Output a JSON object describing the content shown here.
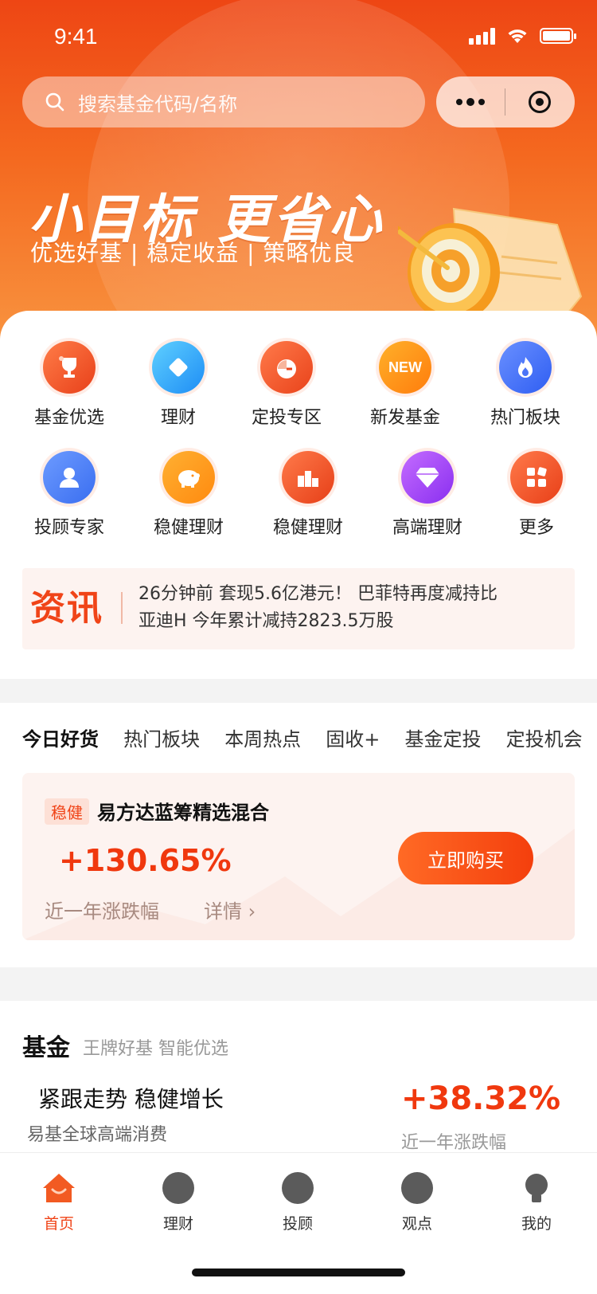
{
  "status_bar": {
    "time": "9:41"
  },
  "search": {
    "placeholder": "搜索基金代码/名称"
  },
  "hero": {
    "slogan": "小目标 更省心",
    "subslogan": "优选好基 | 稳定收益 | 策略优良"
  },
  "menu": [
    {
      "label": "基金优选",
      "icon": "trophy-icon"
    },
    {
      "label": "理财",
      "icon": "diamond-icon"
    },
    {
      "label": "定投专区",
      "icon": "clock-icon"
    },
    {
      "label": "新发基金",
      "icon": "new-badge-icon",
      "badge": "NEW"
    },
    {
      "label": "热门板块",
      "icon": "flame-icon"
    },
    {
      "label": "投顾专家",
      "icon": "person-icon"
    },
    {
      "label": "稳健理财",
      "icon": "piggy-bank-icon"
    },
    {
      "label": "稳健理财",
      "icon": "podium-icon"
    },
    {
      "label": "高端理财",
      "icon": "gem-icon"
    },
    {
      "label": "更多",
      "icon": "grid-icon"
    }
  ],
  "news": {
    "title": "资讯",
    "line1": "26分钟前 套现5.6亿港元！ 巴菲特再度减持比",
    "line2": "亚迪H 今年累计减持2823.5万股"
  },
  "today": {
    "tabs": [
      "今日好货",
      "热门板块",
      "本周热点",
      "固收+",
      "基金定投",
      "定投机会"
    ],
    "card": {
      "tag": "稳健",
      "name": "易方达蓝筹精选混合",
      "rate": "+130.65%",
      "rate_label": "近一年涨跌幅",
      "detail": "详情 ›",
      "buy": "立即购买"
    }
  },
  "fund_section": {
    "title": "基金",
    "subtitle": "王牌好基 智能优选",
    "pick_title": "紧跟走势 稳健增长",
    "pick_sub": "易基全球高端消费",
    "pick_rate": "+38.32%",
    "pick_rate_label": "近一年涨跌幅"
  },
  "tabbar": [
    {
      "label": "首页",
      "active": true
    },
    {
      "label": "理财",
      "active": false
    },
    {
      "label": "投顾",
      "active": false
    },
    {
      "label": "观点",
      "active": false
    },
    {
      "label": "我的",
      "active": false
    }
  ],
  "colors": {
    "brand": "#f04418",
    "accent": "#f0380e"
  }
}
